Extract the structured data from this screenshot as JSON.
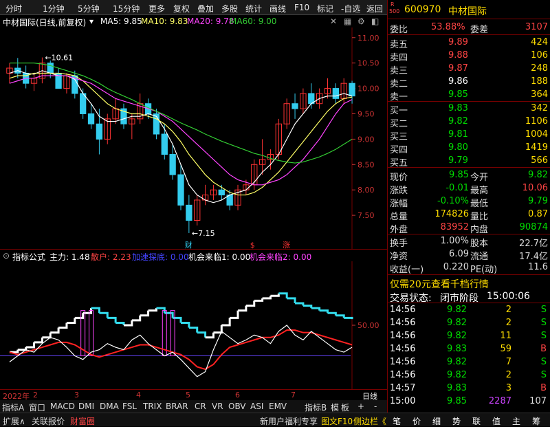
{
  "toolbar": {
    "items": [
      "分时",
      "1分钟",
      "5分钟",
      "15分钟",
      "更多",
      "复权",
      "叠加",
      "多股",
      "统计",
      "画线",
      "F10",
      "标记",
      "-自选",
      "返回"
    ]
  },
  "chart_header": {
    "title": "中材国际(日线,前复权)",
    "ma5": "MA5: 9.85",
    "ma10": "MA10: 9.83",
    "ma20": "MA20: 9.78",
    "ma60": "MA60: 9.00"
  },
  "chart_data": [
    {
      "type": "line",
      "title": "中材国际(日线,前复权)",
      "ylim": [
        7.0,
        11.2
      ],
      "yticks": [
        "11.00",
        "10.50",
        "10.00",
        "9.50",
        "9.00",
        "8.50",
        "8.00",
        "7.50"
      ],
      "annotations": {
        "high": "10.61",
        "low": "7.15"
      },
      "markers": [
        "财",
        "$",
        "涨"
      ],
      "candles": [
        [
          10.3,
          10.5,
          10.1,
          10.4
        ],
        [
          10.4,
          10.6,
          10.2,
          10.3
        ],
        [
          10.3,
          10.45,
          10.0,
          10.1
        ],
        [
          10.1,
          10.3,
          9.95,
          10.2
        ],
        [
          10.2,
          10.61,
          10.1,
          10.5
        ],
        [
          10.5,
          10.55,
          10.2,
          10.3
        ],
        [
          10.3,
          10.4,
          10.0,
          10.0
        ],
        [
          10.0,
          10.3,
          9.9,
          10.25
        ],
        [
          10.25,
          10.35,
          9.8,
          9.9
        ],
        [
          9.9,
          10.0,
          9.4,
          9.5
        ],
        [
          9.5,
          9.7,
          9.2,
          9.3
        ],
        [
          9.3,
          9.6,
          8.7,
          9.0
        ],
        [
          9.0,
          9.5,
          8.9,
          9.4
        ],
        [
          9.4,
          9.8,
          9.3,
          9.6
        ],
        [
          9.6,
          9.7,
          9.2,
          9.3
        ],
        [
          9.3,
          9.5,
          9.0,
          9.4
        ],
        [
          9.4,
          9.9,
          9.3,
          9.7
        ],
        [
          9.7,
          9.8,
          9.4,
          9.5
        ],
        [
          9.5,
          9.6,
          9.0,
          9.1
        ],
        [
          9.1,
          9.3,
          8.6,
          8.7
        ],
        [
          8.7,
          8.9,
          8.2,
          8.3
        ],
        [
          8.3,
          8.5,
          7.6,
          7.7
        ],
        [
          7.7,
          7.9,
          7.15,
          7.4
        ],
        [
          7.4,
          7.9,
          7.3,
          7.8
        ],
        [
          7.8,
          8.1,
          7.7,
          7.9
        ],
        [
          7.9,
          8.1,
          7.8,
          8.0
        ],
        [
          8.0,
          8.1,
          7.8,
          7.9
        ],
        [
          7.9,
          8.0,
          7.6,
          7.7
        ],
        [
          7.7,
          8.1,
          7.6,
          8.0
        ],
        [
          8.0,
          8.2,
          7.9,
          8.1
        ],
        [
          8.1,
          8.6,
          8.0,
          8.5
        ],
        [
          8.5,
          9.0,
          8.3,
          8.6
        ],
        [
          8.6,
          8.8,
          8.4,
          8.7
        ],
        [
          8.7,
          9.4,
          8.6,
          9.3
        ],
        [
          9.3,
          9.8,
          9.2,
          9.7
        ],
        [
          9.7,
          9.9,
          9.4,
          9.6
        ],
        [
          9.6,
          10.0,
          9.5,
          9.9
        ],
        [
          9.9,
          10.1,
          9.6,
          9.7
        ],
        [
          9.7,
          10.0,
          9.6,
          9.9
        ],
        [
          9.9,
          10.2,
          9.8,
          10.0
        ],
        [
          10.0,
          10.1,
          9.7,
          9.8
        ],
        [
          9.8,
          10.2,
          9.7,
          10.1
        ],
        [
          10.1,
          10.15,
          9.7,
          9.85
        ]
      ],
      "series": [
        {
          "name": "MA5",
          "color": "#ffffff",
          "values": [
            10.3,
            10.35,
            10.3,
            10.28,
            10.35,
            10.3,
            10.25,
            10.25,
            10.18,
            9.9,
            9.7,
            9.45,
            9.35,
            9.35,
            9.4,
            9.45,
            9.45,
            9.5,
            9.45,
            9.2,
            8.9,
            8.5,
            8.1,
            7.9,
            7.8,
            7.75,
            7.8,
            7.9,
            7.95,
            8.0,
            8.15,
            8.35,
            8.5,
            8.7,
            9.0,
            9.3,
            9.5,
            9.7,
            9.8,
            9.85,
            9.85,
            9.9,
            9.85
          ]
        },
        {
          "name": "MA10",
          "color": "#ffff66",
          "values": [
            10.2,
            10.25,
            10.25,
            10.3,
            10.3,
            10.3,
            10.3,
            10.28,
            10.25,
            10.15,
            10.0,
            9.85,
            9.7,
            9.6,
            9.55,
            9.5,
            9.5,
            9.45,
            9.4,
            9.3,
            9.15,
            8.95,
            8.7,
            8.5,
            8.3,
            8.15,
            8.05,
            7.95,
            7.9,
            7.9,
            7.95,
            8.05,
            8.2,
            8.35,
            8.55,
            8.75,
            8.95,
            9.15,
            9.35,
            9.55,
            9.7,
            9.8,
            9.83
          ]
        },
        {
          "name": "MA20",
          "color": "#ff44ff",
          "values": [
            10.1,
            10.15,
            10.2,
            10.2,
            10.25,
            10.25,
            10.25,
            10.25,
            10.2,
            10.15,
            10.1,
            10.0,
            9.9,
            9.8,
            9.75,
            9.7,
            9.65,
            9.6,
            9.55,
            9.45,
            9.35,
            9.2,
            9.05,
            8.9,
            8.75,
            8.6,
            8.45,
            8.3,
            8.2,
            8.15,
            8.1,
            8.1,
            8.15,
            8.2,
            8.3,
            8.45,
            8.6,
            8.8,
            9.0,
            9.25,
            9.5,
            9.7,
            9.78
          ]
        },
        {
          "name": "MA60",
          "color": "#33cc33",
          "values": [
            10.5,
            10.5,
            10.5,
            10.5,
            10.48,
            10.45,
            10.4,
            10.35,
            10.3,
            10.25,
            10.18,
            10.1,
            10.0,
            9.92,
            9.85,
            9.78,
            9.7,
            9.62,
            9.55,
            9.48,
            9.4,
            9.32,
            9.25,
            9.18,
            9.1,
            9.03,
            8.96,
            8.9,
            8.84,
            8.78,
            8.72,
            8.68,
            8.62,
            8.58,
            8.55,
            8.53,
            8.55,
            8.6,
            8.65,
            8.72,
            8.8,
            8.9,
            9.0
          ]
        }
      ]
    },
    {
      "type": "line",
      "title": "指标公式",
      "ylim": [
        0,
        100
      ],
      "yticks": [
        "50.00"
      ],
      "series": [
        {
          "name": "主力",
          "color": "#ffffff",
          "values": [
            20,
            25,
            30,
            28,
            35,
            40,
            38,
            32,
            25,
            22,
            28,
            30,
            35,
            32,
            30,
            38,
            42,
            35,
            30,
            25,
            28,
            22,
            15,
            8,
            12,
            30,
            45,
            40,
            35,
            38,
            42,
            40,
            35,
            45,
            50,
            42,
            38,
            45,
            40,
            35,
            30,
            28,
            32
          ]
        },
        {
          "name": "散户",
          "color": "#ff2222",
          "values": [
            28,
            26,
            28,
            30,
            32,
            34,
            36,
            36,
            34,
            30,
            26,
            24,
            26,
            28,
            30,
            32,
            34,
            34,
            32,
            30,
            28,
            26,
            22,
            16,
            14,
            18,
            26,
            32,
            34,
            36,
            38,
            40,
            40,
            42,
            46,
            46,
            44,
            44,
            42,
            40,
            38,
            36,
            34
          ]
        },
        {
          "name": "机会来临1",
          "color": "#ffffff",
          "values": [
            28,
            30,
            32,
            36,
            40,
            44,
            48,
            52,
            56,
            60,
            64,
            60,
            56,
            52,
            50,
            54,
            58,
            62,
            64,
            60,
            56,
            52,
            48,
            44,
            40,
            44,
            50,
            56,
            62,
            66,
            70,
            72,
            74,
            76,
            72,
            68,
            66,
            64,
            62,
            60,
            58,
            56,
            55
          ]
        }
      ]
    }
  ],
  "indicator_header": {
    "name": "指标公式",
    "zhuli": "主力: 1.48",
    "sanhu": "散户: 2.23",
    "jiasu": "加速探底: 0.00",
    "jihui1": "机会来临1: 0.00",
    "jihui2": "机会来临2: 0.00"
  },
  "date_axis": {
    "labels": [
      "2022年",
      "2",
      "3",
      "4",
      "5",
      "6",
      "7"
    ],
    "right_label": "日线"
  },
  "tabs": [
    "指标A",
    "窗口",
    "MACD",
    "DMI",
    "DMA",
    "FSL",
    "TRIX",
    "BRAR",
    "CR",
    "VR",
    "OBV",
    "ASI",
    "EMV",
    "指标B",
    "模",
    "板",
    "+",
    "-"
  ],
  "bottom_bar": {
    "left": [
      "扩展∧",
      "关联报价",
      "财富圈"
    ],
    "middle": [
      "新用户福利专享",
      "图文F10",
      "侧边栏《"
    ],
    "right": [
      "笔",
      "价",
      "细",
      "势",
      "联",
      "值",
      "主",
      "筹"
    ]
  },
  "quote": {
    "market_badge": "R",
    "badge_num": "500",
    "code": "600970",
    "name": "中材国际",
    "weibi_label": "委比",
    "weibi": "53.88%",
    "weicha_label": "委差",
    "weicha": "3107",
    "asks": [
      {
        "label": "卖五",
        "price": "9.89",
        "vol": "424",
        "color": "#ff4444"
      },
      {
        "label": "卖四",
        "price": "9.88",
        "vol": "106",
        "color": "#ff4444"
      },
      {
        "label": "卖三",
        "price": "9.87",
        "vol": "248",
        "color": "#ff4444"
      },
      {
        "label": "卖二",
        "price": "9.86",
        "vol": "188",
        "color": "#ffffff"
      },
      {
        "label": "卖一",
        "price": "9.85",
        "vol": "364",
        "color": "#00dd00"
      }
    ],
    "bids": [
      {
        "label": "买一",
        "price": "9.83",
        "vol": "342",
        "color": "#00dd00"
      },
      {
        "label": "买二",
        "price": "9.82",
        "vol": "1106",
        "color": "#00dd00"
      },
      {
        "label": "买三",
        "price": "9.81",
        "vol": "1004",
        "color": "#00dd00"
      },
      {
        "label": "买四",
        "price": "9.80",
        "vol": "1419",
        "color": "#00dd00"
      },
      {
        "label": "买五",
        "price": "9.79",
        "vol": "566",
        "color": "#00dd00"
      }
    ],
    "stats": [
      {
        "l1": "现价",
        "v1": "9.85",
        "c1": "#00dd00",
        "l2": "今开",
        "v2": "9.82",
        "c2": "#00dd00"
      },
      {
        "l1": "涨跌",
        "v1": "-0.01",
        "c1": "#00dd00",
        "l2": "最高",
        "v2": "10.06",
        "c2": "#ff4444"
      },
      {
        "l1": "涨幅",
        "v1": "-0.10%",
        "c1": "#00dd00",
        "l2": "最低",
        "v2": "9.79",
        "c2": "#00dd00"
      },
      {
        "l1": "总量",
        "v1": "174826",
        "c1": "#ffdd00",
        "l2": "量比",
        "v2": "0.87",
        "c2": "#ffdd00"
      },
      {
        "l1": "外盘",
        "v1": "83952",
        "c1": "#ff4444",
        "l2": "内盘",
        "v2": "90874",
        "c2": "#00dd00"
      }
    ],
    "stats2": [
      {
        "l1": "换手",
        "v1": "1.00%",
        "l2": "股本",
        "v2": "22.7亿"
      },
      {
        "l1": "净资",
        "v1": "6.09",
        "l2": "流通",
        "v2": "17.4亿"
      },
      {
        "l1": "收益(一)",
        "v1": "0.220",
        "l2": "PE(动)",
        "v2": "11.6"
      }
    ],
    "promo": "仅需20元查看千档行情",
    "trade_status_label": "交易状态:",
    "trade_status": "闭市阶段",
    "trade_time": "15:00:06",
    "ticks": [
      {
        "t": "14:56",
        "p": "9.82",
        "v": "2",
        "d": "S",
        "pc": "#00dd00",
        "vc": "#ffdd00",
        "dc": "#00dd00"
      },
      {
        "t": "14:56",
        "p": "9.82",
        "v": "2",
        "d": "S",
        "pc": "#00dd00",
        "vc": "#ffdd00",
        "dc": "#00dd00"
      },
      {
        "t": "14:56",
        "p": "9.82",
        "v": "11",
        "d": "S",
        "pc": "#00dd00",
        "vc": "#ffdd00",
        "dc": "#00dd00"
      },
      {
        "t": "14:56",
        "p": "9.83",
        "v": "59",
        "d": "B",
        "pc": "#00dd00",
        "vc": "#ffdd00",
        "dc": "#ff4444"
      },
      {
        "t": "14:56",
        "p": "9.82",
        "v": "7",
        "d": "S",
        "pc": "#00dd00",
        "vc": "#ffdd00",
        "dc": "#00dd00"
      },
      {
        "t": "14:56",
        "p": "9.82",
        "v": "2",
        "d": "S",
        "pc": "#00dd00",
        "vc": "#ffdd00",
        "dc": "#00dd00"
      },
      {
        "t": "14:57",
        "p": "9.83",
        "v": "3",
        "d": "B",
        "pc": "#00dd00",
        "vc": "#ffdd00",
        "dc": "#ff4444"
      },
      {
        "t": "15:00",
        "p": "9.85",
        "v": "2287",
        "d": "107",
        "pc": "#00dd00",
        "vc": "#cc44ff",
        "dc": "#dddddd"
      }
    ]
  }
}
